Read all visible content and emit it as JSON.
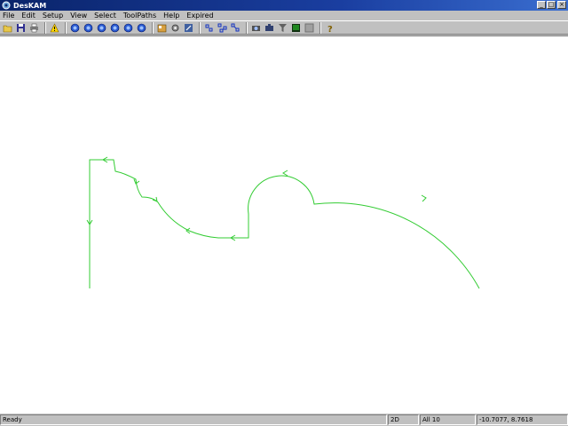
{
  "window": {
    "title": "DesKAM"
  },
  "menu": {
    "items": [
      {
        "label": "File"
      },
      {
        "label": "Edit"
      },
      {
        "label": "Setup"
      },
      {
        "label": "View"
      },
      {
        "label": "Select"
      },
      {
        "label": "ToolPaths"
      },
      {
        "label": "Help"
      },
      {
        "label": "Expired"
      }
    ]
  },
  "toolbar": {
    "buttons": [
      {
        "icon": "open-folder-icon"
      },
      {
        "icon": "save-icon"
      },
      {
        "icon": "print-icon"
      },
      {
        "icon": "warning-icon"
      },
      {
        "icon": "zoom-in-icon"
      },
      {
        "icon": "zoom-out-icon"
      },
      {
        "icon": "zoom-window-icon"
      },
      {
        "icon": "zoom-all-icon"
      },
      {
        "icon": "zoom-prev-icon"
      },
      {
        "icon": "zoom-extents-icon"
      },
      {
        "icon": "tool-library-icon"
      },
      {
        "icon": "settings-icon"
      },
      {
        "icon": "machine-icon"
      },
      {
        "icon": "select-point-icon"
      },
      {
        "icon": "select-chain-icon"
      },
      {
        "icon": "select-all-icon"
      },
      {
        "icon": "camera-icon"
      },
      {
        "icon": "simulate-icon"
      },
      {
        "icon": "filter-icon"
      },
      {
        "icon": "layers-icon"
      },
      {
        "icon": "grid-icon"
      },
      {
        "icon": "help-icon"
      }
    ]
  },
  "status": {
    "message": "Ready",
    "mode": "2D",
    "selection": "All 10",
    "coords": "-10.7077, 8.7618"
  },
  "colors": {
    "toolpath": "#33cc33",
    "titlebar": "#0a246a"
  }
}
